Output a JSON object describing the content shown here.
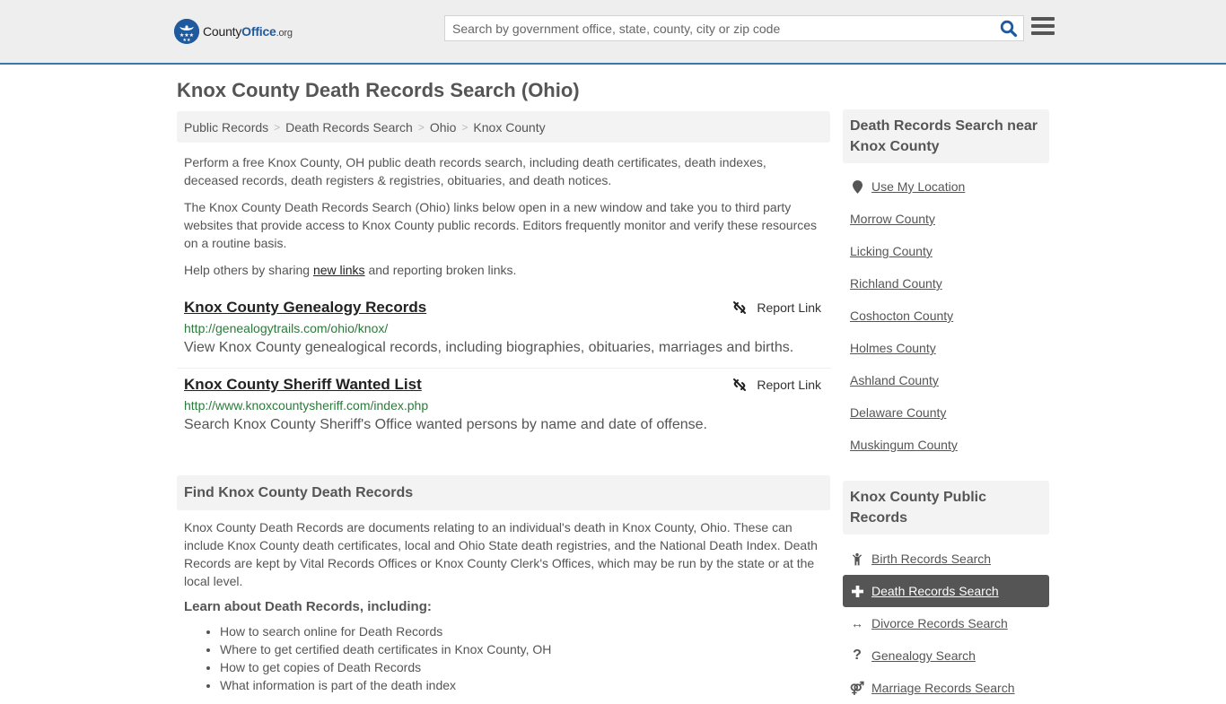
{
  "header": {
    "logo": {
      "part1": "County",
      "part2": "Office",
      "part3": ".org"
    },
    "search": {
      "placeholder": "Search by government office, state, county, city or zip code",
      "value": ""
    },
    "icons": {
      "search": "search-icon",
      "menu": "hamburger-menu-icon"
    }
  },
  "page": {
    "title": "Knox County Death Records Search (Ohio)"
  },
  "breadcrumb": [
    {
      "label": "Public Records"
    },
    {
      "label": "Death Records Search"
    },
    {
      "label": "Ohio"
    },
    {
      "label": "Knox County"
    }
  ],
  "intro": {
    "p1": "Perform a free Knox County, OH public death records search, including death certificates, death indexes, deceased records, death registers & registries, obituaries, and death notices.",
    "p2": "The Knox County Death Records Search (Ohio) links below open in a new window and take you to third party websites that provide access to Knox County public records. Editors frequently monitor and verify these resources on a routine basis.",
    "p3_before": "Help others by sharing ",
    "p3_link": "new links",
    "p3_after": " and reporting broken links."
  },
  "records": [
    {
      "title": "Knox County Genealogy Records",
      "url": "http://genealogytrails.com/ohio/knox/",
      "description": "View Knox County genealogical records, including biographies, obituaries, marriages and births.",
      "report_label": "Report Link"
    },
    {
      "title": "Knox County Sheriff Wanted List",
      "url": "http://www.knoxcountysheriff.com/index.php",
      "description": "Search Knox County Sheriff's Office wanted persons by name and date of offense.",
      "report_label": "Report Link"
    }
  ],
  "find_section": {
    "heading": "Find Knox County Death Records",
    "body": "Knox County Death Records are documents relating to an individual's death in Knox County, Ohio. These can include Knox County death certificates, local and Ohio State death registries, and the National Death Index. Death Records are kept by Vital Records Offices or Knox County Clerk's Offices, which may be run by the state or at the local level.",
    "learn_heading": "Learn about Death Records, including:",
    "learn_items": [
      "How to search online for Death Records",
      "Where to get certified death certificates in Knox County, OH",
      "How to get copies of Death Records",
      "What information is part of the death index"
    ]
  },
  "sidebar": {
    "nearby": {
      "heading": "Death Records Search near Knox County",
      "use_location": "Use My Location",
      "counties": [
        "Morrow County",
        "Licking County",
        "Richland County",
        "Coshocton County",
        "Holmes County",
        "Ashland County",
        "Delaware County",
        "Muskingum County"
      ]
    },
    "public_records": {
      "heading": "Knox County Public Records",
      "items": [
        {
          "label": "Birth Records Search",
          "icon": "child-icon",
          "glyph": "🚸"
        },
        {
          "label": "Death Records Search",
          "icon": "plus-icon",
          "glyph": "✚",
          "active": true
        },
        {
          "label": "Divorce Records Search",
          "icon": "arrows-horizontal-icon",
          "glyph": "↔"
        },
        {
          "label": "Genealogy Search",
          "icon": "question-icon",
          "glyph": "?"
        },
        {
          "label": "Marriage Records Search",
          "icon": "marriage-icon",
          "glyph": "⚤"
        }
      ]
    }
  }
}
